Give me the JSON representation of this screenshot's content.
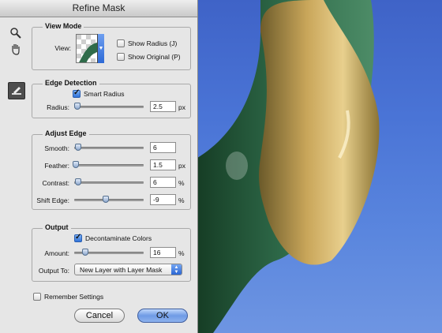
{
  "dialog": {
    "title": "Refine Mask"
  },
  "view_mode": {
    "title": "View Mode",
    "view_label": "View:",
    "show_radius": {
      "label": "Show Radius (J)",
      "checked": false
    },
    "show_original": {
      "label": "Show Original (P)",
      "checked": false
    }
  },
  "edge_detection": {
    "title": "Edge Detection",
    "smart_radius": {
      "label": "Smart Radius",
      "checked": true
    },
    "radius": {
      "label": "Radius:",
      "value": "2.5",
      "unit": "px",
      "slider_fraction": 0.04
    }
  },
  "adjust_edge": {
    "title": "Adjust Edge",
    "smooth": {
      "label": "Smooth:",
      "value": "6",
      "slider_fraction": 0.06
    },
    "feather": {
      "label": "Feather:",
      "value": "1.5",
      "unit": "px",
      "slider_fraction": 0.02
    },
    "contrast": {
      "label": "Contrast:",
      "value": "6",
      "unit": "%",
      "slider_fraction": 0.06
    },
    "shift_edge": {
      "label": "Shift Edge:",
      "value": "-9",
      "unit": "%",
      "slider_fraction": 0.45
    }
  },
  "output": {
    "title": "Output",
    "decontaminate": {
      "label": "Decontaminate Colors",
      "checked": true
    },
    "amount": {
      "label": "Amount:",
      "value": "16",
      "unit": "%",
      "slider_fraction": 0.16
    },
    "output_to": {
      "label": "Output To:",
      "selected": "New Layer with Layer Mask"
    }
  },
  "remember_settings": {
    "label": "Remember Settings",
    "checked": false
  },
  "buttons": {
    "cancel": "Cancel",
    "ok": "OK"
  },
  "tools": [
    "zoom-tool",
    "hand-tool",
    "refine-radius-tool"
  ]
}
